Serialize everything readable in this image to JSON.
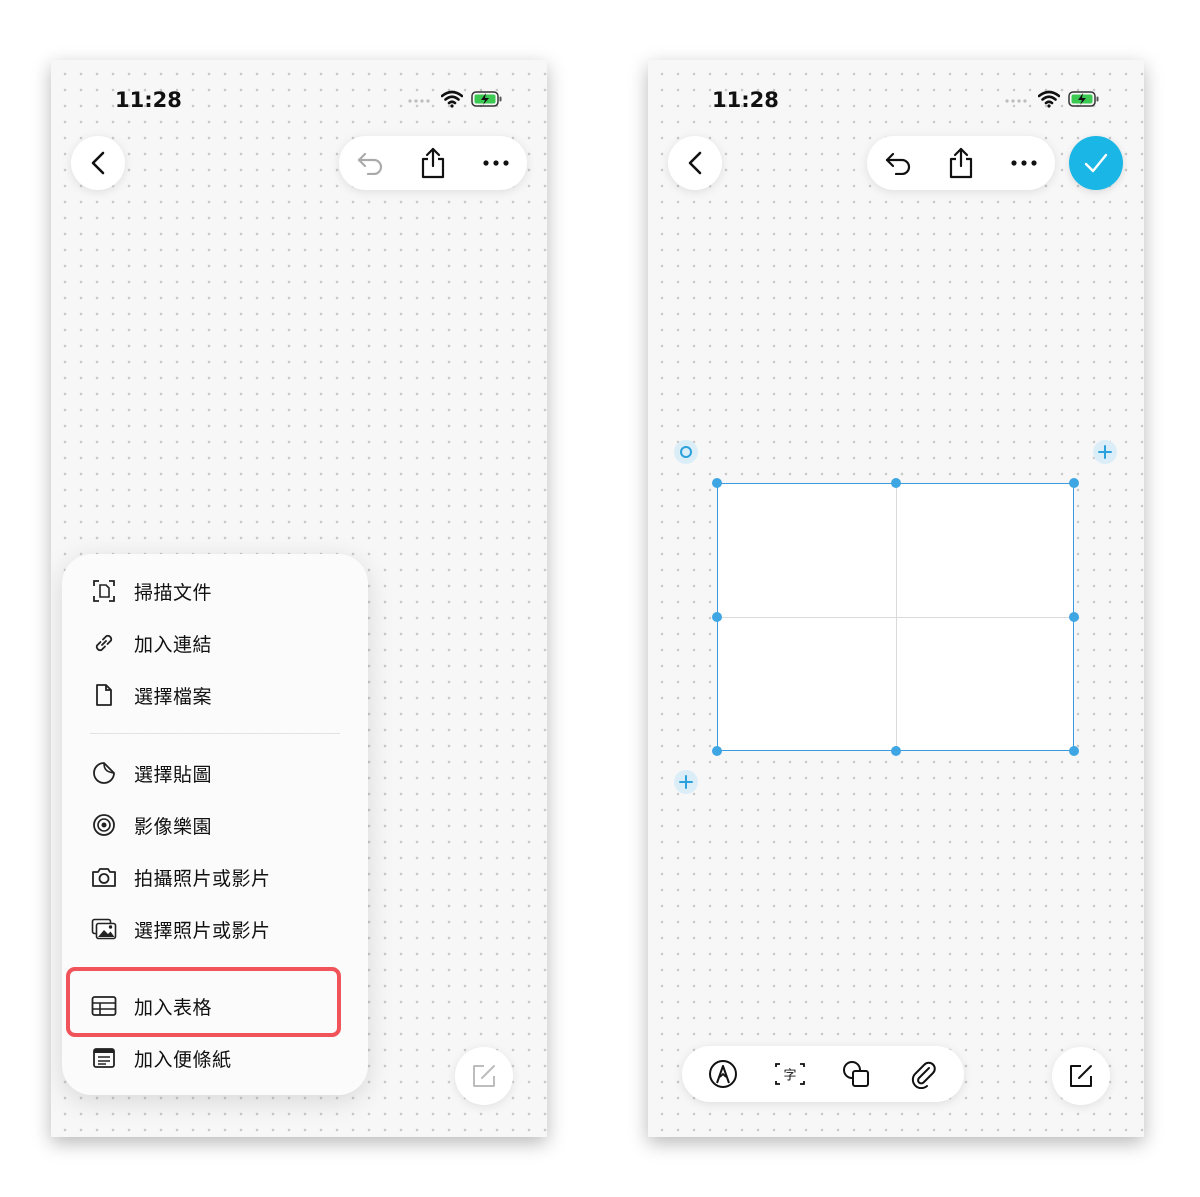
{
  "left_screen": {
    "status": {
      "time": "11:28"
    },
    "menu": {
      "group1": [
        {
          "label": "掃描文件",
          "icon": "scan-document-icon"
        },
        {
          "label": "加入連結",
          "icon": "link-icon"
        },
        {
          "label": "選擇檔案",
          "icon": "file-icon"
        }
      ],
      "group2": [
        {
          "label": "選擇貼圖",
          "icon": "sticker-icon"
        },
        {
          "label": "影像樂園",
          "icon": "image-playground-icon"
        },
        {
          "label": "拍攝照片或影片",
          "icon": "camera-icon"
        },
        {
          "label": "選擇照片或影片",
          "icon": "photo-library-icon"
        }
      ],
      "group3": [
        {
          "label": "加入表格",
          "icon": "table-icon"
        },
        {
          "label": "加入便條紙",
          "icon": "sticky-note-icon"
        }
      ]
    },
    "highlight_color": "#f0545a"
  },
  "right_screen": {
    "status": {
      "time": "11:28"
    },
    "table": {
      "rows": 2,
      "columns": 2,
      "selection_color": "#3c9ae0"
    },
    "accent": "#1ab6e6",
    "bottom_tools": [
      "pen-icon",
      "text-box-icon",
      "shapes-icon",
      "attachment-icon"
    ]
  }
}
